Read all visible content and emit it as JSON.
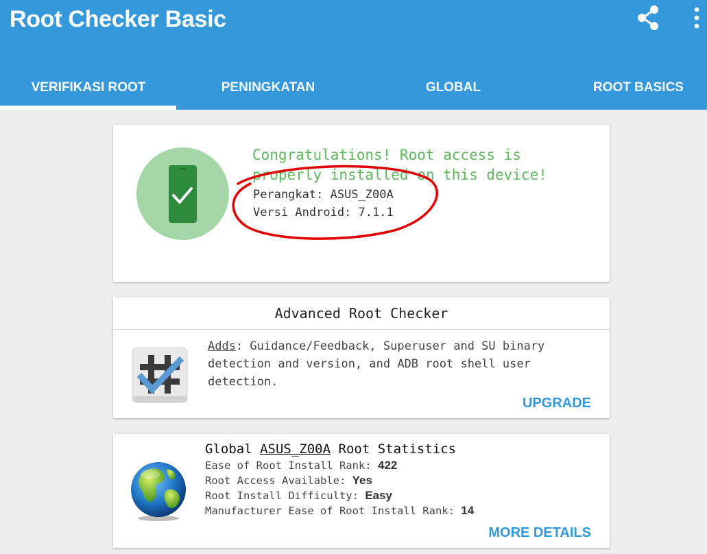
{
  "app": {
    "title": "Root Checker Basic",
    "share_icon": "share-icon",
    "more_icon": "more-vert-icon",
    "primary_color": "#3498db"
  },
  "tabs": [
    {
      "label": "VERIFIKASI ROOT",
      "selected": true
    },
    {
      "label": "PENINGKATAN",
      "selected": false
    },
    {
      "label": "GLOBAL",
      "selected": false
    },
    {
      "label": "ROOT BASICS",
      "selected": false
    }
  ],
  "result": {
    "icon": "phone-check-icon",
    "message": "Congratulations! Root access is properly installed on this device!",
    "device_label": "Perangkat:",
    "device_value": "ASUS_Z00A",
    "android_label": "Versi Android:",
    "android_value": "7.1.1",
    "message_color": "#5cb85c",
    "annotation_color": "#e00000"
  },
  "advanced": {
    "title": "Advanced Root Checker",
    "icon": "root-checker-tool-icon",
    "adds_label": "Adds",
    "description": ": Guidance/Feedback, Superuser and SU binary detection and version, and ADB root shell user detection.",
    "upgrade_label": "UPGRADE"
  },
  "stats": {
    "icon": "globe-icon",
    "title_prefix": "Global",
    "device": "ASUS_Z00A",
    "title_suffix": "Root Statistics",
    "rows": [
      {
        "label": "Ease of Root Install Rank:",
        "value": "422"
      },
      {
        "label": "Root Access Available:",
        "value": "Yes"
      },
      {
        "label": "Root Install Difficulty:",
        "value": "Easy"
      },
      {
        "label": "Manufacturer Ease of Root Install Rank:",
        "value": "14"
      }
    ],
    "more_label": "MORE DETAILS"
  }
}
